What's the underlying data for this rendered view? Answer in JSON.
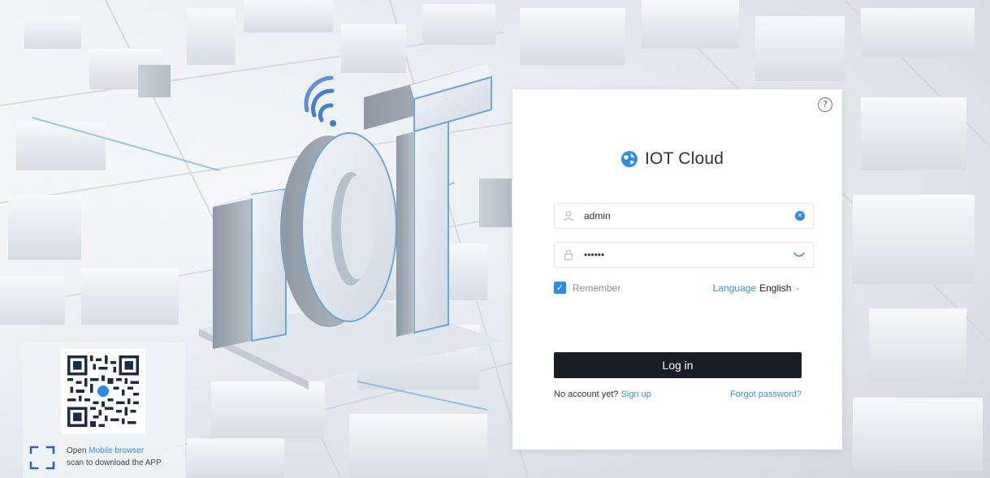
{
  "hero": {
    "logo_text": "IOT"
  },
  "login": {
    "brand_title": "IOT Cloud",
    "username_value": "admin",
    "password_value": "••••••",
    "remember_label": "Remember",
    "remember_checked": true,
    "language_label": "Language",
    "language_value": "English",
    "login_button": "Log in",
    "no_account_text": "No account yet?",
    "signup_link": "Sign up",
    "forgot_link": "Forgot password?"
  },
  "app_download": {
    "open_text": "Open",
    "browser_link": "Mobile browser",
    "scan_text": "scan to download the APP"
  },
  "colors": {
    "accent": "#2e8ce8",
    "button": "#181d26",
    "link": "#3b8fe0"
  },
  "icons": [
    "help-icon",
    "globe-icon",
    "user-icon",
    "lock-icon",
    "clear-icon",
    "eye-icon",
    "checkbox-icon",
    "chevron-down-icon",
    "wifi-icon",
    "qr-code",
    "scan-icon"
  ]
}
